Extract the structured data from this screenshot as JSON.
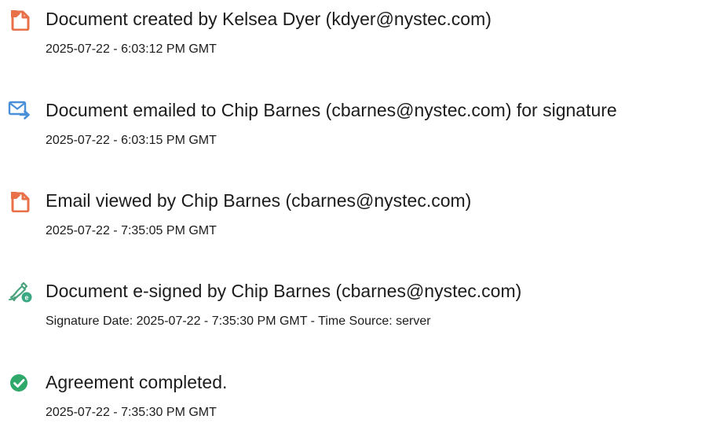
{
  "events": [
    {
      "icon": "document-created-icon",
      "title": "Document created by Kelsea Dyer (kdyer@nystec.com)",
      "timestamp": "2025-07-22 - 6:03:12 PM GMT"
    },
    {
      "icon": "email-sent-icon",
      "title": "Document emailed to Chip Barnes (cbarnes@nystec.com) for signature",
      "timestamp": "2025-07-22 - 6:03:15 PM GMT"
    },
    {
      "icon": "document-viewed-icon",
      "title": "Email viewed by Chip Barnes (cbarnes@nystec.com)",
      "timestamp": "2025-07-22 - 7:35:05 PM GMT"
    },
    {
      "icon": "e-signature-icon",
      "title": "Document e-signed by Chip Barnes (cbarnes@nystec.com)",
      "timestamp": "Signature Date: 2025-07-22 - 7:35:30 PM GMT - Time Source: server"
    },
    {
      "icon": "agreement-completed-icon",
      "title": "Agreement completed.",
      "timestamp": "2025-07-22 - 7:35:30 PM GMT"
    }
  ],
  "colors": {
    "document_icon": "#e8714a",
    "email_icon": "#4a90d9",
    "signature_icon": "#3aa882",
    "completed_icon": "#2fa86a"
  }
}
